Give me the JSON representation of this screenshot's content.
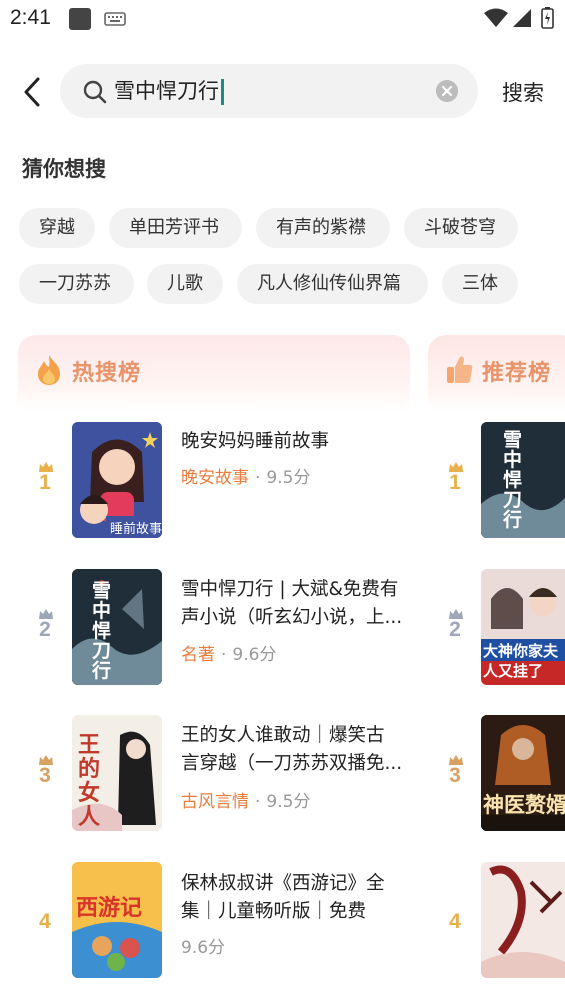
{
  "status_bar": {
    "time": "2:41"
  },
  "search": {
    "query": "雪中悍刀行",
    "button_label": "搜索"
  },
  "suggestions": {
    "title": "猜你想搜",
    "chips": [
      "穿越",
      "单田芳评书",
      "有声的紫襟",
      "斗破苍穹",
      "一刀苏苏",
      "儿歌",
      "凡人修仙传仙界篇",
      "三体"
    ]
  },
  "hot_list": {
    "title": "热搜榜",
    "items": [
      {
        "rank": "1",
        "title_line1": "晚安妈妈睡前故事",
        "title_line2": "",
        "tag": "晚安故事",
        "score": "9.5分",
        "cover_text": "睡前故事"
      },
      {
        "rank": "2",
        "title_line1": "雪中悍刀行 | 大斌&免费有",
        "title_line2": "声小说（听玄幻小说，上...",
        "tag": "名著",
        "score": "9.6分",
        "cover_text": "雪中悍刀行"
      },
      {
        "rank": "3",
        "title_line1": "王的女人谁敢动｜爆笑古",
        "title_line2": "言穿越（一刀苏苏双播免...",
        "tag": "古风言情",
        "score": "9.5分",
        "cover_text": "王的女人"
      },
      {
        "rank": "4",
        "title_line1": "保林叔叔讲《西游记》全",
        "title_line2": "集｜儿童畅听版｜免费",
        "tag": "",
        "score": "9.6分",
        "cover_text": "西游记"
      }
    ]
  },
  "recommend_list": {
    "title": "推荐榜",
    "items": [
      {
        "rank": "1",
        "cover_text": "雪中悍刀行"
      },
      {
        "rank": "2",
        "cover_text": "大神你家夫人又挂了"
      },
      {
        "rank": "3",
        "cover_text": "神医赘婿"
      },
      {
        "rank": "4",
        "cover_text": ""
      }
    ]
  },
  "colors": {
    "accent": "#e87d3e",
    "caret": "#1f8a85",
    "chip_bg": "#f2f2f2",
    "gold": "#e8b04a"
  }
}
